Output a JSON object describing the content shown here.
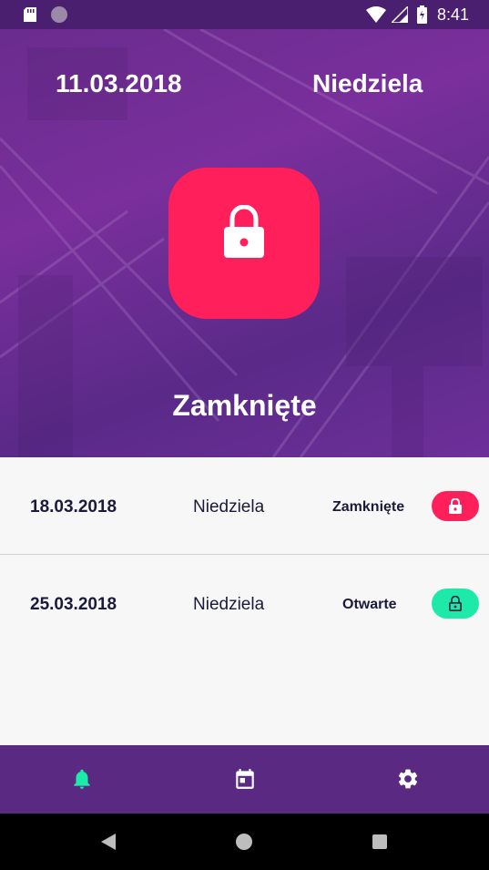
{
  "status_bar": {
    "time": "8:41"
  },
  "hero": {
    "date": "11.03.2018",
    "day": "Niedziela",
    "status": "Zamknięte",
    "lock_icon": "lock-icon",
    "accent_color": "#ff1f5a"
  },
  "list": {
    "rows": [
      {
        "date": "18.03.2018",
        "day": "Niedziela",
        "status": "Zamknięte",
        "icon": "lock-closed-icon",
        "color": "#ff1f5a"
      },
      {
        "date": "25.03.2018",
        "day": "Niedziela",
        "status": "Otwarte",
        "icon": "lock-open-icon",
        "color": "#1de9a8"
      }
    ]
  },
  "bottom_nav": {
    "items": [
      {
        "icon": "bell-icon",
        "active": true,
        "color": "#1de9a8"
      },
      {
        "icon": "calendar-icon",
        "active": false,
        "color": "#ffffff"
      },
      {
        "icon": "gear-icon",
        "active": false,
        "color": "#ffffff"
      }
    ]
  },
  "system_nav": {
    "icons": [
      "back-icon",
      "home-icon",
      "recents-icon"
    ]
  }
}
